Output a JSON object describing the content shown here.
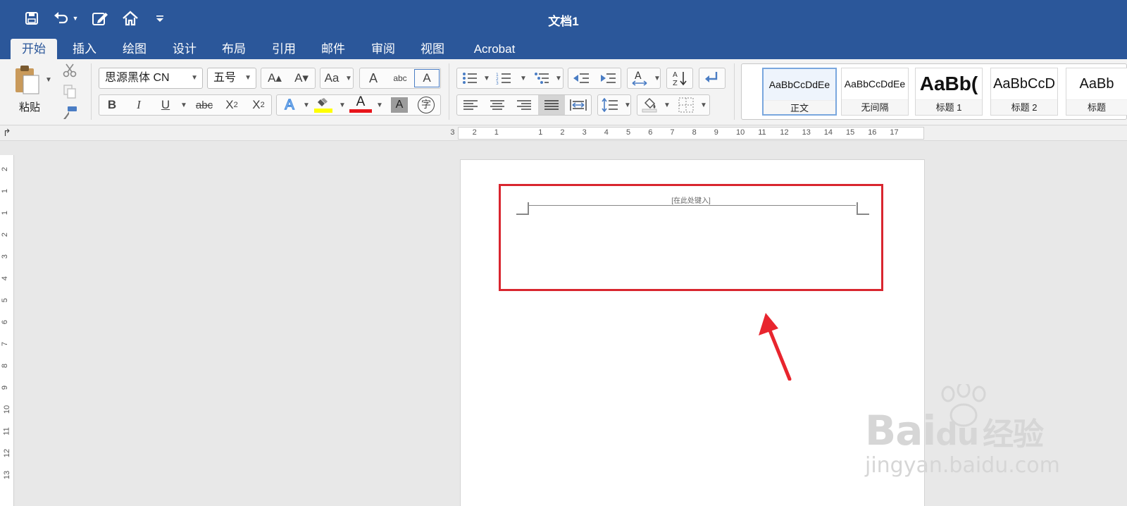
{
  "window": {
    "title": "文档1"
  },
  "quick_access": {
    "icons": [
      "save-icon",
      "undo-icon",
      "undo-dropdown-icon",
      "edit-doc-icon",
      "home-icon",
      "customize-dropdown-icon"
    ]
  },
  "tabs": [
    {
      "label": "开始",
      "active": true
    },
    {
      "label": "插入"
    },
    {
      "label": "绘图"
    },
    {
      "label": "设计"
    },
    {
      "label": "布局"
    },
    {
      "label": "引用"
    },
    {
      "label": "邮件"
    },
    {
      "label": "审阅"
    },
    {
      "label": "视图"
    },
    {
      "label": "Acrobat"
    }
  ],
  "clipboard": {
    "paste_label": "粘贴"
  },
  "font": {
    "family": "思源黑体 CN",
    "size": "五号",
    "increase_label": "A▴",
    "decrease_label": "A▾",
    "case_label": "Aa",
    "clear_label": "A",
    "phonetic_label": "abc",
    "border_label": "A",
    "bold": "B",
    "italic": "I",
    "underline": "U",
    "strike": "abc",
    "sub_base": "X",
    "sub_exp": "2",
    "sup_base": "X",
    "sup_exp": "2",
    "effects_label": "A",
    "font_color_label": "A",
    "shading_label": "A",
    "enclose_label": "字",
    "highlight_color": "#ffff00",
    "font_color": "#e8151b"
  },
  "styles": [
    {
      "preview": "AaBbCcDdEe",
      "name": "正文",
      "selected": true
    },
    {
      "preview": "AaBbCcDdEe",
      "name": "无间隔"
    },
    {
      "preview": "AaBb(",
      "name": "标题 1"
    },
    {
      "preview": "AaBbCcD",
      "name": "标题 2"
    },
    {
      "preview": "AaBb",
      "name": "标题"
    }
  ],
  "ruler": {
    "h_labels": [
      "3",
      "2",
      "1",
      "1",
      "2",
      "3",
      "4",
      "5",
      "6",
      "7",
      "8",
      "9",
      "10",
      "11",
      "12",
      "13",
      "14",
      "15",
      "16",
      "17"
    ],
    "v_labels": [
      "2",
      "1",
      "1",
      "2",
      "3",
      "4",
      "5",
      "6",
      "7",
      "8",
      "9",
      "10",
      "11",
      "12",
      "13"
    ]
  },
  "document": {
    "header_placeholder": "[在此处键入]"
  },
  "watermark": {
    "brand_left": "Bai",
    "brand_mid": "du",
    "brand_right": "经验",
    "url": "jingyan.baidu.com"
  },
  "colors": {
    "accent": "#2b579a",
    "highlight": "#d9262f"
  }
}
